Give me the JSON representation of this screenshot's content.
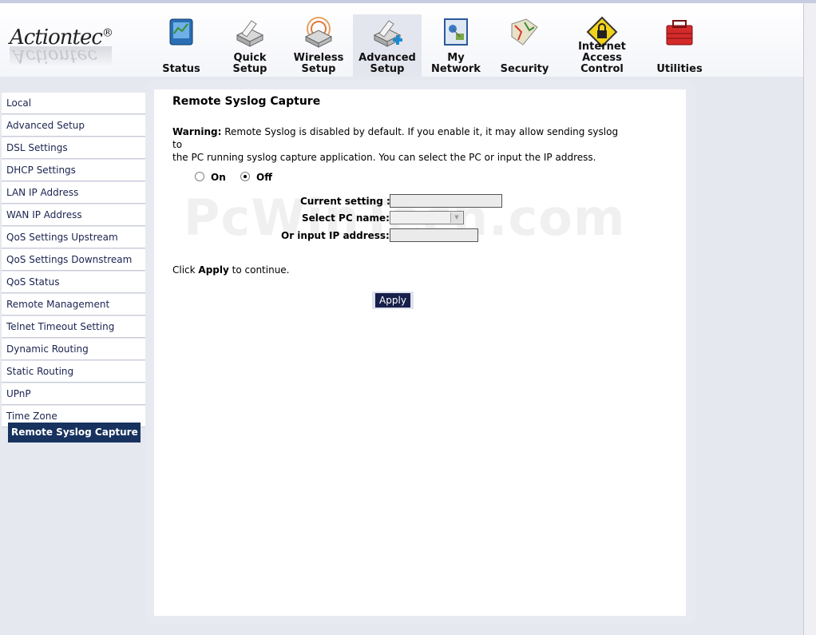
{
  "brand": {
    "name": "Actiontec",
    "mark": "®"
  },
  "nav": [
    {
      "label_1": "Status",
      "label_2": "",
      "icon": "status-icon"
    },
    {
      "label_1": "Quick",
      "label_2": "Setup",
      "icon": "quick-setup-icon"
    },
    {
      "label_1": "Wireless",
      "label_2": "Setup",
      "icon": "wireless-setup-icon"
    },
    {
      "label_1": "Advanced",
      "label_2": "Setup",
      "icon": "advanced-setup-icon"
    },
    {
      "label_1": "My Network",
      "label_2": "",
      "icon": "my-network-icon"
    },
    {
      "label_1": "Security",
      "label_2": "",
      "icon": "security-icon"
    },
    {
      "label_1": "Internet Access",
      "label_2": "Control",
      "icon": "internet-access-control-icon"
    },
    {
      "label_1": "Utilities",
      "label_2": "",
      "icon": "utilities-icon"
    }
  ],
  "sidebar": {
    "items": [
      "Local",
      "Advanced Setup",
      "DSL Settings",
      "DHCP Settings",
      "LAN IP Address",
      "WAN IP Address",
      "QoS Settings Upstream",
      "QoS Settings Downstream",
      "QoS Status",
      "Remote Management",
      "Telnet Timeout Setting",
      "Dynamic Routing",
      "Static Routing",
      "UPnP",
      "Time Zone"
    ],
    "active": "Remote Syslog Capture"
  },
  "page": {
    "title": "Remote Syslog Capture",
    "warning_label": "Warning:",
    "warning_line1": " Remote Syslog is disabled by default. If you enable it, it may allow sending syslog to",
    "warning_line2": "the PC running syslog capture application. You can select the PC or input the IP address.",
    "radio_on": "On",
    "radio_off": "Off",
    "current_setting_label": "Current setting :",
    "current_setting_value": "",
    "select_pc_label": "Select PC name:",
    "select_pc_value": "",
    "ip_label": "Or input IP address:",
    "ip_value": "",
    "click_prefix": "Click ",
    "click_bold": "Apply",
    "click_suffix": " to continue.",
    "apply_button": "Apply"
  },
  "watermark": "PcWinTech.com",
  "colors": {
    "active_sidebar": "#17325e",
    "apply_button": "#17204a",
    "panel_bg": "#e8eaf2"
  }
}
